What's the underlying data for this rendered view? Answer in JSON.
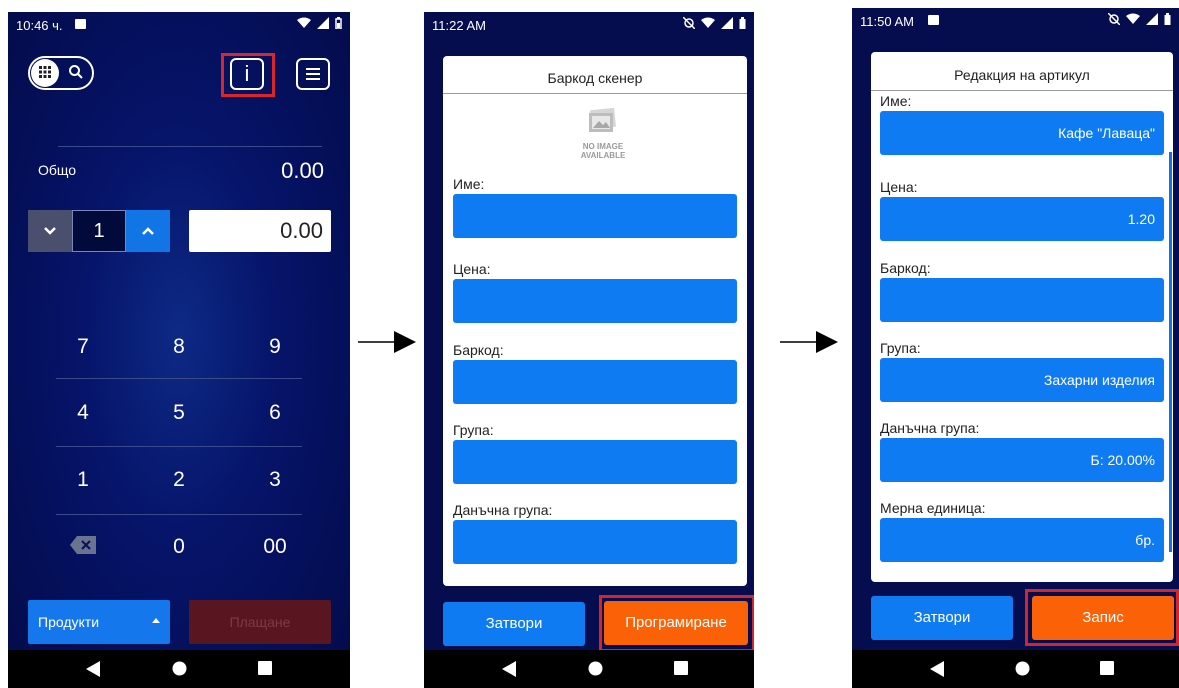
{
  "screen1": {
    "status_time": "10:46 ч.",
    "total_label": "Общо",
    "total_value": "0.00",
    "quantity": "1",
    "amount": "0.00",
    "keypad": [
      "7",
      "8",
      "9",
      "4",
      "5",
      "6",
      "1",
      "2",
      "3",
      "0",
      "00"
    ],
    "products_button": "Продукти",
    "pay_button": "Плащане"
  },
  "screen2": {
    "status_time": "11:22 AM",
    "dialog_title": "Баркод скенер",
    "no_image_line1": "NO IMAGE",
    "no_image_line2": "AVAILABLE",
    "fields": [
      {
        "label": "Име:",
        "value": ""
      },
      {
        "label": "Цена:",
        "value": ""
      },
      {
        "label": "Баркод:",
        "value": ""
      },
      {
        "label": "Група:",
        "value": ""
      },
      {
        "label": "Данъчна група:",
        "value": ""
      }
    ],
    "close_button": "Затвори",
    "program_button": "Програмиране"
  },
  "screen3": {
    "status_time": "11:50 AM",
    "dialog_title": "Редакция на артикул",
    "fields": [
      {
        "label": "Име:",
        "value": "Кафе \"Лаваца\""
      },
      {
        "label": "Цена:",
        "value": "1.20"
      },
      {
        "label": "Баркод:",
        "value": ""
      },
      {
        "label": "Група:",
        "value": "Захарни изделия"
      },
      {
        "label": "Данъчна група:",
        "value": "Б: 20.00%"
      },
      {
        "label": "Мерна единица:",
        "value": "бр."
      }
    ],
    "close_button": "Затвори",
    "save_button": "Запис"
  },
  "colors": {
    "accent_blue": "#0f7bf2",
    "accent_orange": "#fb6208",
    "highlight_red": "#d0262c",
    "background_navy": "#050d4f"
  }
}
